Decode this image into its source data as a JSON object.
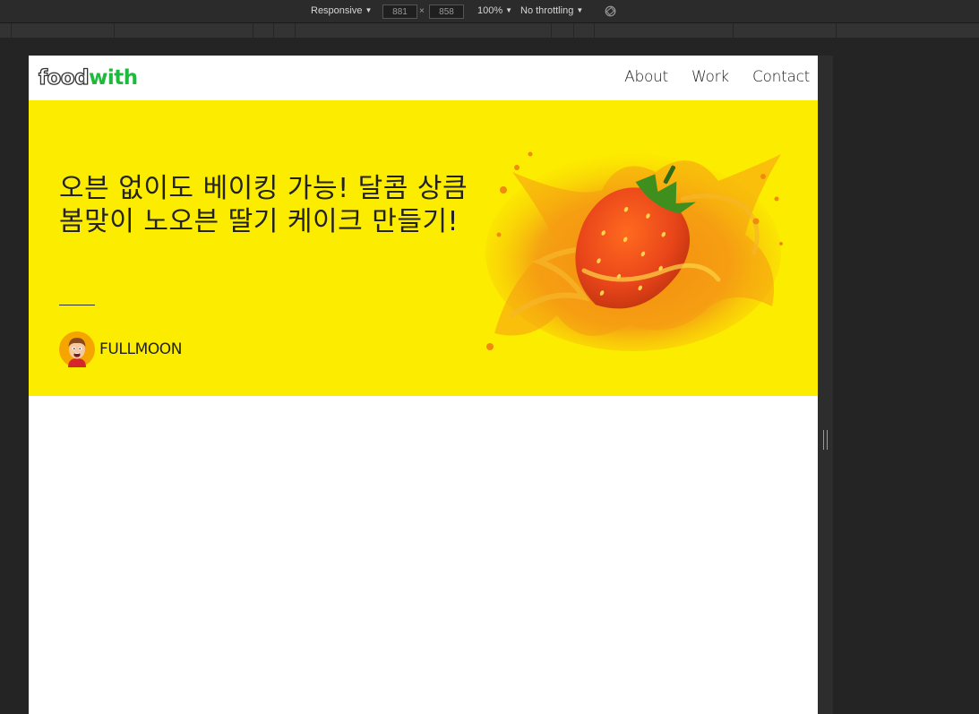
{
  "devtools": {
    "device_mode": "Responsive",
    "width": "881",
    "height": "858",
    "zoom": "100%",
    "throttling": "No throttling",
    "times": "×"
  },
  "site": {
    "logo": {
      "part1": "food",
      "part2": "with"
    },
    "nav": [
      "About",
      "Work",
      "Contact"
    ],
    "colors": {
      "accent": "#1dba3c",
      "hero_bg": "#fcec00"
    }
  },
  "hero": {
    "title": "오븐 없이도 베이킹 가능! 달콤 상큼 봄맞이 노오븐 딸기 케이크 만들기!",
    "author": "FULLMOON"
  },
  "icons": {
    "rotate": "rotate-icon",
    "avatar": "avatar-illustration",
    "art": "strawberry-splash-illustration"
  }
}
